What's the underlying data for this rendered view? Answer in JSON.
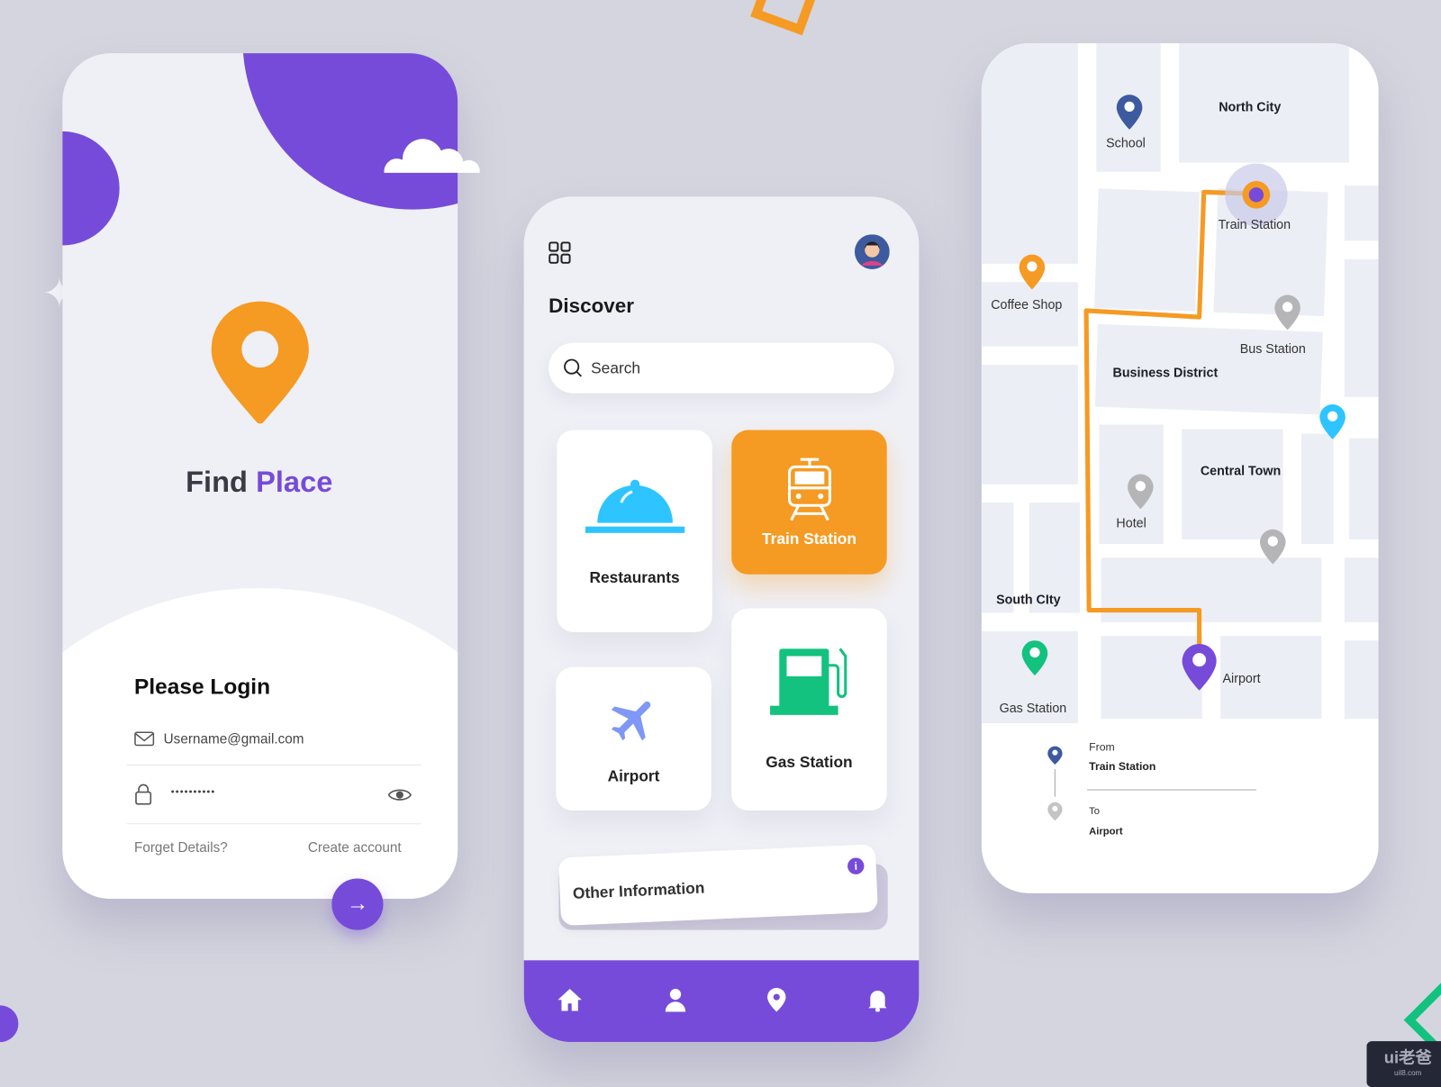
{
  "login": {
    "title_part1": "Find",
    "title_part2": "Place",
    "heading": "Please Login",
    "email_value": "Username@gmail.com",
    "password_value": "••••••••••",
    "forgot_label": "Forget Details?",
    "create_label": "Create account",
    "colors": {
      "purple": "#764bd9",
      "orange": "#f59a23"
    }
  },
  "discover": {
    "title": "Discover",
    "search_placeholder": "Search",
    "categories": [
      {
        "label": "Restaurants",
        "icon": "cloche-icon",
        "color": "#2ec4ff"
      },
      {
        "label": "Train Station",
        "icon": "train-icon",
        "color": "#f59a23",
        "active": true
      },
      {
        "label": "Airport",
        "icon": "airplane-icon",
        "color": "#7f98f5"
      },
      {
        "label": "Gas Station",
        "icon": "fuel-pump-icon",
        "color": "#12c27e"
      }
    ],
    "other_info": "Other Information",
    "nav": [
      "home-icon",
      "user-icon",
      "location-icon",
      "bell-icon"
    ]
  },
  "map": {
    "labels": {
      "school": "School",
      "north_city": "North City",
      "train_station": "Train Station",
      "coffee_shop": "Coffee Shop",
      "bus_station": "Bus Station",
      "business_district": "Business District",
      "central_town": "Central Town",
      "hotel": "Hotel",
      "south_city": "South CIty",
      "airport": "Airport",
      "gas_station": "Gas Station"
    },
    "route": {
      "from_label": "From",
      "from_value": "Train Station",
      "to_label": "To",
      "to_value": "Airport"
    },
    "route_color": "#f59a23"
  },
  "watermark": {
    "text": "ui老爸",
    "sub": "uil8.com"
  }
}
